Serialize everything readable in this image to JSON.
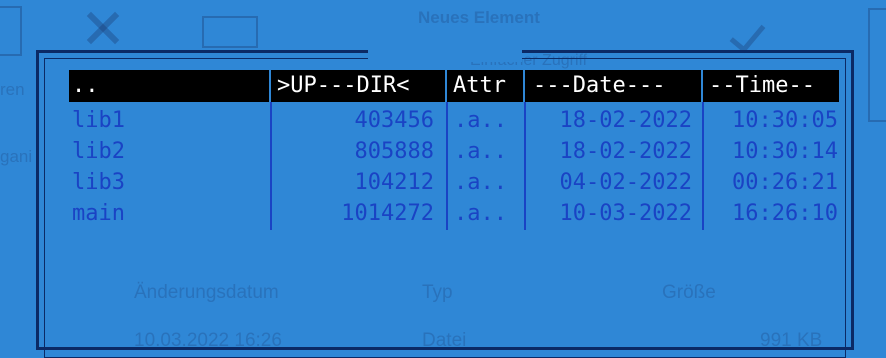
{
  "background_ui": {
    "new_item_label": "Neues Element",
    "access_label": "Einfacher Zugriff",
    "column_date": "Änderungsdatum",
    "column_type": "Typ",
    "column_size": "Größe",
    "left_fragment": "ren",
    "left_fragment2": "gani",
    "partial_row": "10.03.2022 16:26",
    "partial_type": "Datei",
    "partial_size": "991 KB"
  },
  "panel": {
    "headers": {
      "name": "..",
      "size": ">UP---DIR<",
      "attr": "Attr",
      "date": "---Date---",
      "time": "--Time--"
    },
    "files": [
      {
        "name": "lib1",
        "size": "403456",
        "attr": ".a..",
        "date": "18-02-2022",
        "time": "10:30:05"
      },
      {
        "name": "lib2",
        "size": "805888",
        "attr": ".a..",
        "date": "18-02-2022",
        "time": "10:30:14"
      },
      {
        "name": "lib3",
        "size": "104212",
        "attr": ".a..",
        "date": "04-02-2022",
        "time": "00:26:21"
      },
      {
        "name": "main",
        "size": "1014272",
        "attr": ".a..",
        "date": "10-03-2022",
        "time": "16:26:10"
      }
    ]
  },
  "colors": {
    "background": "#2f87d6",
    "file_text": "#1a43c4",
    "header_bg": "#000000",
    "frame": "#0b2a66"
  }
}
